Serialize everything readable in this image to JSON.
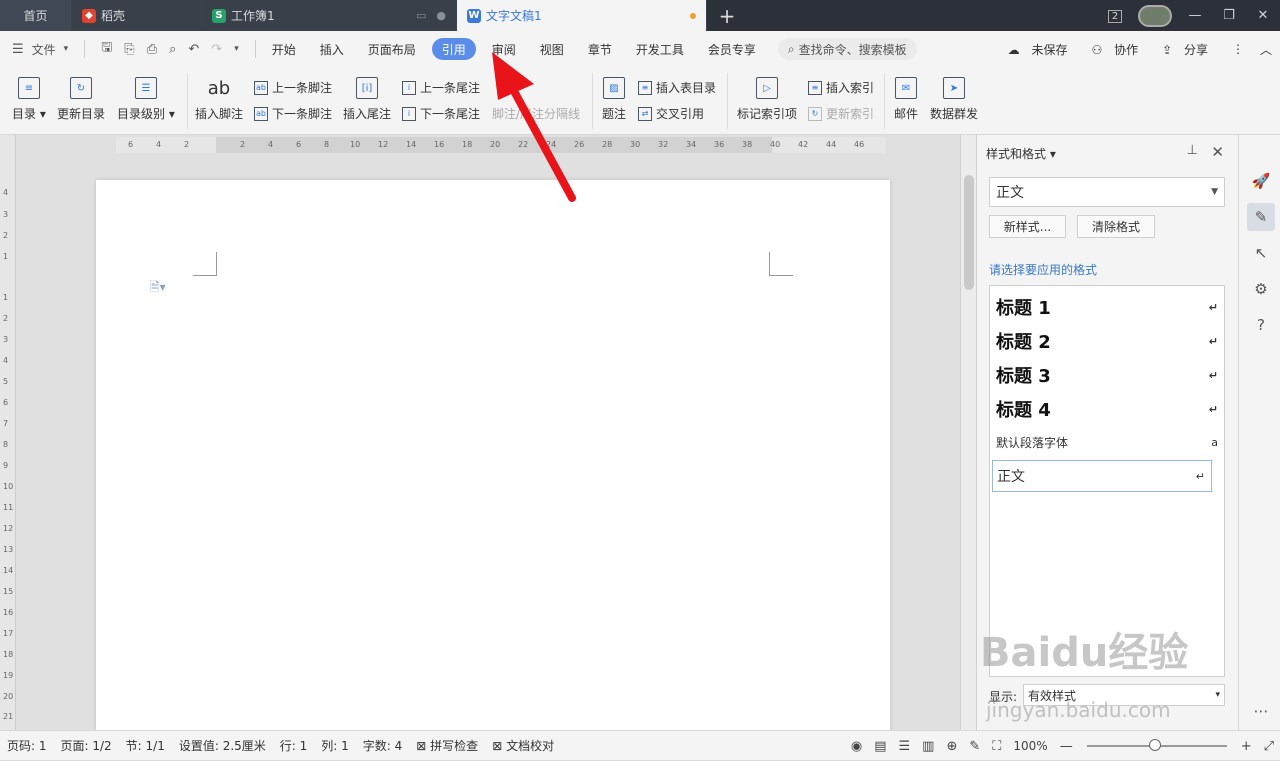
{
  "tabs": {
    "home": "首页",
    "t1": "稻壳",
    "t2": "工作簿1",
    "t3": "文字文稿1",
    "add": "+"
  },
  "window": {
    "badge": "2",
    "min": "—",
    "restore": "❐",
    "close": "✕"
  },
  "menubar": {
    "file": "文件",
    "items": [
      "开始",
      "插入",
      "页面布局",
      "引用",
      "审阅",
      "视图",
      "章节",
      "开发工具",
      "会员专享"
    ],
    "active_index": 3,
    "search": "查找命令、搜索模板",
    "unsaved": "未保存",
    "collab": "协作",
    "share": "分享"
  },
  "ribbon": {
    "toc": "目录",
    "update_toc": "更新目录",
    "toc_level": "目录级别",
    "insert_footnote": "插入脚注",
    "prev_footnote": "上一条脚注",
    "next_footnote": "下一条脚注",
    "insert_endnote": "插入尾注",
    "prev_endnote": "上一条尾注",
    "next_endnote": "下一条尾注",
    "footnote_sep": "脚注/尾注分隔线",
    "caption": "题注",
    "insert_table_toc": "插入表目录",
    "cross_ref": "交叉引用",
    "mark_index": "标记索引项",
    "insert_index": "插入索引",
    "update_index": "更新索引",
    "mail": "邮件",
    "mail_merge": "数据群发"
  },
  "ruler": {
    "h": [
      "6",
      "4",
      "2",
      "2",
      "4",
      "6",
      "8",
      "10",
      "12",
      "14",
      "16",
      "18",
      "20",
      "22",
      "24",
      "26",
      "28",
      "30",
      "32",
      "34",
      "36",
      "38",
      "40",
      "42",
      "44",
      "46"
    ],
    "v": [
      "4",
      "3",
      "2",
      "1",
      "1",
      "2",
      "3",
      "4",
      "5",
      "6",
      "7",
      "8",
      "9",
      "10",
      "11",
      "12",
      "13",
      "14",
      "15",
      "16",
      "17",
      "18",
      "19",
      "20",
      "21"
    ]
  },
  "panel": {
    "title": "样式和格式",
    "current": "正文",
    "new_style": "新样式...",
    "clear_format": "清除格式",
    "choose_label": "请选择要应用的格式",
    "styles": [
      {
        "name": "标题 1",
        "mark": "↵"
      },
      {
        "name": "标题 2",
        "mark": "↵"
      },
      {
        "name": "标题 3",
        "mark": "↵"
      },
      {
        "name": "标题 4",
        "mark": "↵"
      },
      {
        "name": "默认段落字体",
        "mark": "a"
      },
      {
        "name": "正文",
        "mark": "↵"
      }
    ],
    "show_label": "显示:",
    "show_value": "有效样式"
  },
  "status": {
    "page_no": "页码: 1",
    "pages": "页面: 1/2",
    "section": "节: 1/1",
    "setting": "设置值: 2.5厘米",
    "row": "行: 1",
    "col": "列: 1",
    "words": "字数: 4",
    "spell": "拼写检查",
    "proof": "文档校对",
    "zoom": "100%"
  },
  "watermark": {
    "text": "Baidu经验",
    "url": "jingyan.baidu.com"
  }
}
